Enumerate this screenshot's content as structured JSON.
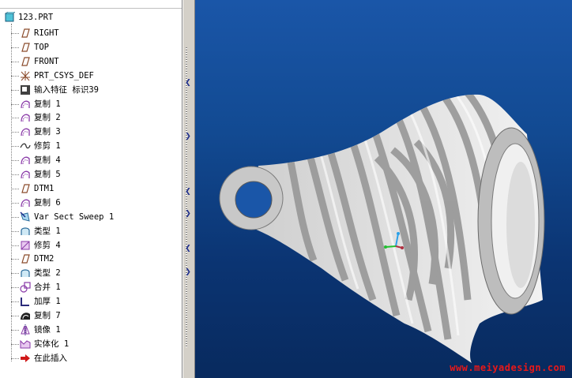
{
  "model_tree": {
    "root": "123.PRT",
    "items": [
      {
        "label": "RIGHT",
        "icon": "datum-plane-icon"
      },
      {
        "label": "TOP",
        "icon": "datum-plane-icon"
      },
      {
        "label": "FRONT",
        "icon": "datum-plane-icon"
      },
      {
        "label": "PRT_CSYS_DEF",
        "icon": "coordinate-system-icon"
      },
      {
        "label": "输入特征 标识39",
        "icon": "import-feature-icon"
      },
      {
        "label": "复制 1",
        "icon": "copy-surface-icon"
      },
      {
        "label": "复制 2",
        "icon": "copy-surface-icon"
      },
      {
        "label": "复制 3",
        "icon": "copy-surface-icon"
      },
      {
        "label": "修剪 1",
        "icon": "trim-curve-icon"
      },
      {
        "label": "复制 4",
        "icon": "copy-surface-icon"
      },
      {
        "label": "复制 5",
        "icon": "copy-surface-icon"
      },
      {
        "label": "DTM1",
        "icon": "datum-plane-icon"
      },
      {
        "label": "复制 6",
        "icon": "copy-surface-icon"
      },
      {
        "label": "Var Sect Sweep 1",
        "icon": "var-sweep-icon"
      },
      {
        "label": "类型 1",
        "icon": "type-surface-icon"
      },
      {
        "label": "修剪 4",
        "icon": "trim-surface-icon"
      },
      {
        "label": "DTM2",
        "icon": "datum-plane-icon"
      },
      {
        "label": "类型 2",
        "icon": "type-surface-icon"
      },
      {
        "label": "合并 1",
        "icon": "merge-icon"
      },
      {
        "label": "加厚 1",
        "icon": "thicken-icon"
      },
      {
        "label": "复制 7",
        "icon": "copy-solid-icon"
      },
      {
        "label": "镜像 1",
        "icon": "mirror-icon"
      },
      {
        "label": "实体化 1",
        "icon": "solidify-icon"
      },
      {
        "label": "在此插入",
        "icon": "insert-here-arrow-icon"
      }
    ]
  },
  "watermark": "www.meiyadesign.com",
  "colors": {
    "viewport_top": "#1a56a8",
    "viewport_bottom": "#082a5e",
    "watermark": "#e81818",
    "tree_icon_blue": "#1c2c8c",
    "tree_icon_purple": "#8a3aa8"
  }
}
